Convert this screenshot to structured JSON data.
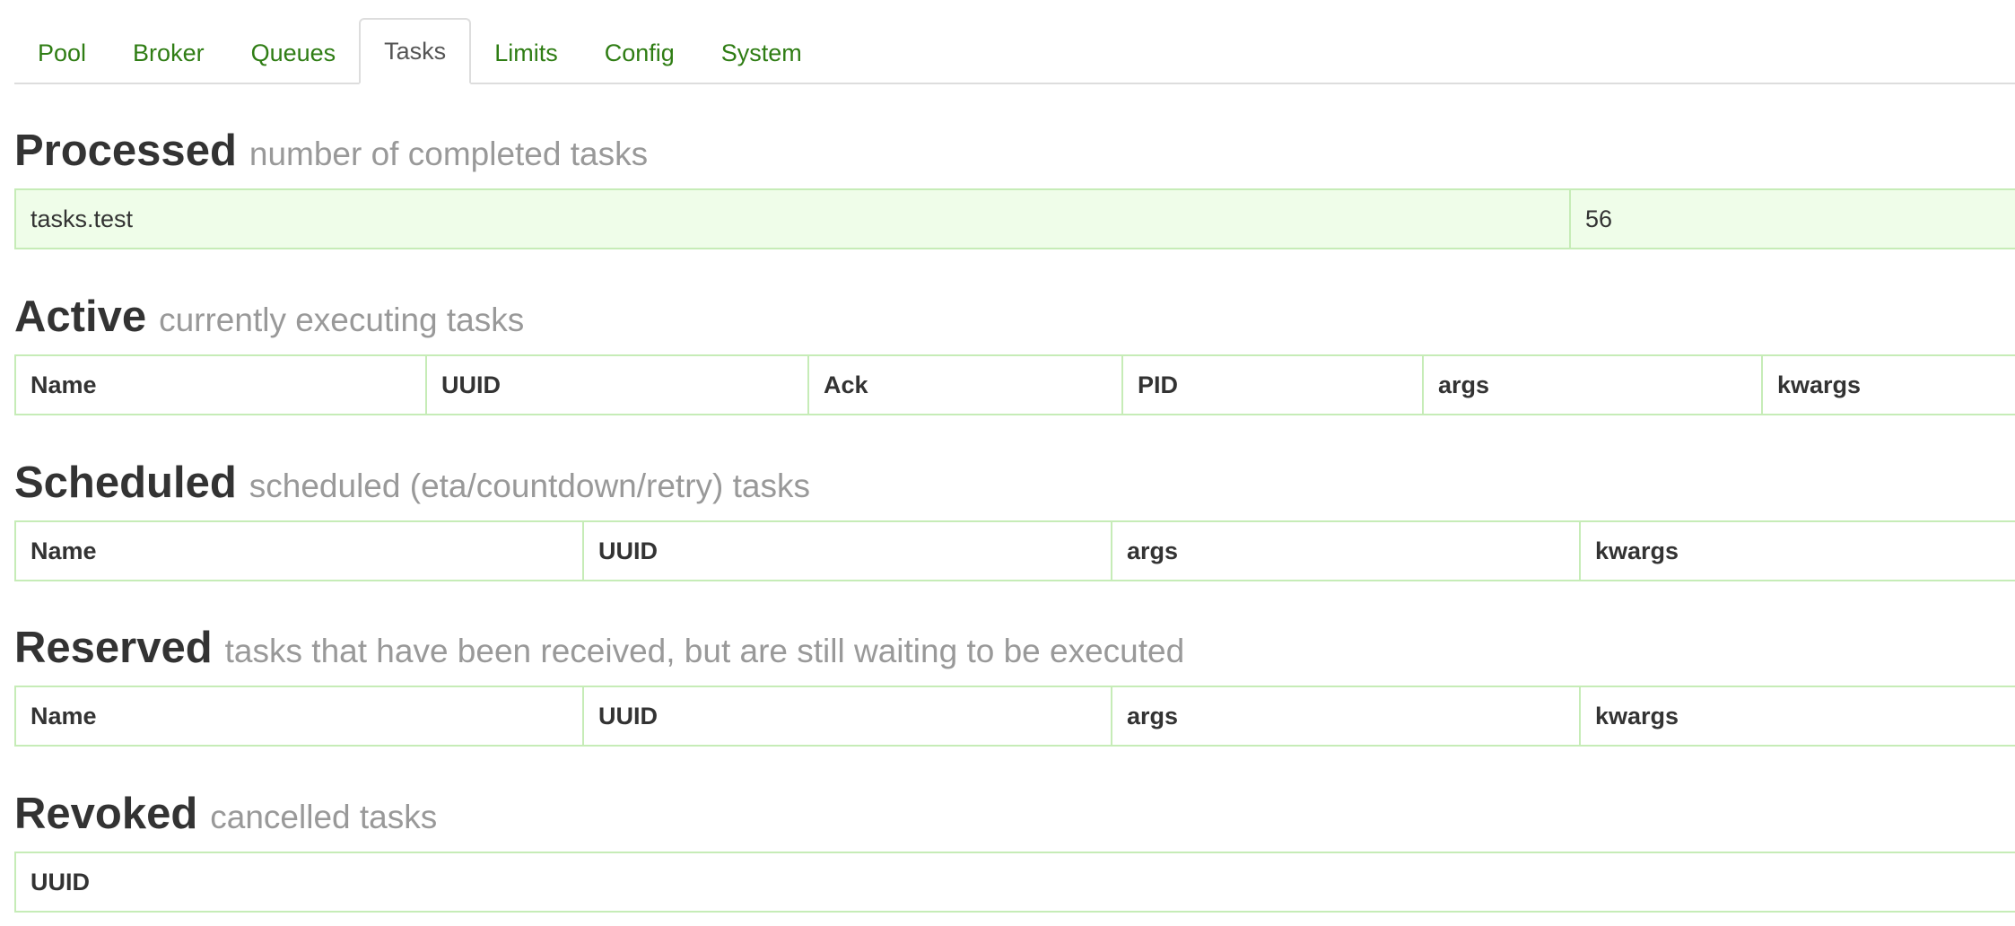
{
  "tabs": [
    {
      "label": "Pool"
    },
    {
      "label": "Broker"
    },
    {
      "label": "Queues"
    },
    {
      "label": "Tasks"
    },
    {
      "label": "Limits"
    },
    {
      "label": "Config"
    },
    {
      "label": "System"
    }
  ],
  "active_tab": "Tasks",
  "processed": {
    "title": "Processed",
    "subtitle": "number of completed tasks",
    "rows": [
      {
        "name": "tasks.test",
        "count": "56"
      }
    ]
  },
  "active": {
    "title": "Active",
    "subtitle": "currently executing tasks",
    "columns": [
      "Name",
      "UUID",
      "Ack",
      "PID",
      "args",
      "kwargs"
    ]
  },
  "scheduled": {
    "title": "Scheduled",
    "subtitle": "scheduled (eta/countdown/retry) tasks",
    "columns": [
      "Name",
      "UUID",
      "args",
      "kwargs"
    ]
  },
  "reserved": {
    "title": "Reserved",
    "subtitle": "tasks that have been received, but are still waiting to be executed",
    "columns": [
      "Name",
      "UUID",
      "args",
      "kwargs"
    ]
  },
  "revoked": {
    "title": "Revoked",
    "subtitle": "cancelled tasks",
    "columns": [
      "UUID"
    ]
  },
  "colors": {
    "tab_link": "#2f7d14",
    "table_border": "#c6ecb7",
    "success_row": "#effde9",
    "heading": "#333333",
    "subtitle": "#999999"
  }
}
